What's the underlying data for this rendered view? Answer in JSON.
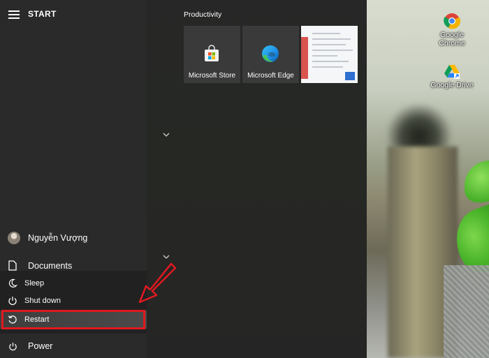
{
  "start_menu": {
    "title": "START",
    "user_name": "Nguyễn Vượng",
    "documents_label": "Documents",
    "power_label": "Power",
    "power_options": [
      {
        "label": "Sleep",
        "icon": "moon-icon"
      },
      {
        "label": "Shut down",
        "icon": "power-icon"
      },
      {
        "label": "Restart",
        "icon": "restart-icon",
        "selected": true
      }
    ]
  },
  "tiles": {
    "group_label": "Productivity",
    "items": [
      {
        "label": "Microsoft Store",
        "icon": "store-icon"
      },
      {
        "label": "Microsoft Edge",
        "icon": "edge-icon"
      },
      {
        "label": "",
        "icon": "document-preview-icon"
      }
    ]
  },
  "desktop": {
    "icons": [
      {
        "label": "Google Chrome",
        "icon": "chrome-icon"
      },
      {
        "label": "Google Drive",
        "icon": "drive-icon"
      }
    ]
  },
  "colors": {
    "highlight_border": "#e0191f",
    "annotation_arrow": "#e0191f",
    "panel_bg": "#2a2a2a"
  }
}
